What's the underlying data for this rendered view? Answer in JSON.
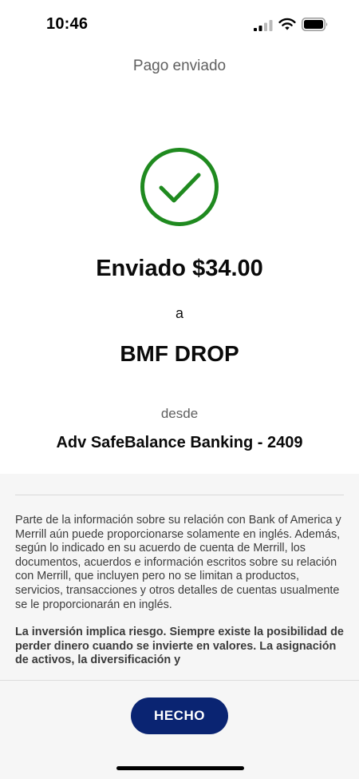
{
  "status_bar": {
    "time": "10:46",
    "icons": [
      "signal-icon",
      "wifi-icon",
      "battery-icon"
    ]
  },
  "header": {
    "title": "Pago enviado"
  },
  "confirmation": {
    "icon": "checkmark-circle-icon",
    "amount_line": "Enviado $34.00",
    "to_word": "a",
    "recipient": "BMF DROP",
    "from_word": "desde",
    "account": "Adv SafeBalance Banking - 2409"
  },
  "disclosure": {
    "paragraph_1": "Parte de la información sobre su relación con Bank of America y Merrill aún puede proporcionarse solamente en inglés. Además, según lo indicado en su acuerdo de cuenta de Merrill, los documentos, acuerdos e información escritos sobre su relación con Merrill, que incluyen pero no se limitan a productos, servicios, transacciones y otros detalles de cuentas usualmente se le proporcionarán en inglés.",
    "paragraph_2": "La inversión implica riesgo. Siempre existe la posibilidad de perder dinero cuando se invierte en valores. La asignación de activos, la diversificación y"
  },
  "footer": {
    "done_label": "HECHO"
  },
  "colors": {
    "success_green": "#1f8a1f",
    "button_navy": "#0a2472",
    "panel_gray": "#f6f6f6"
  }
}
